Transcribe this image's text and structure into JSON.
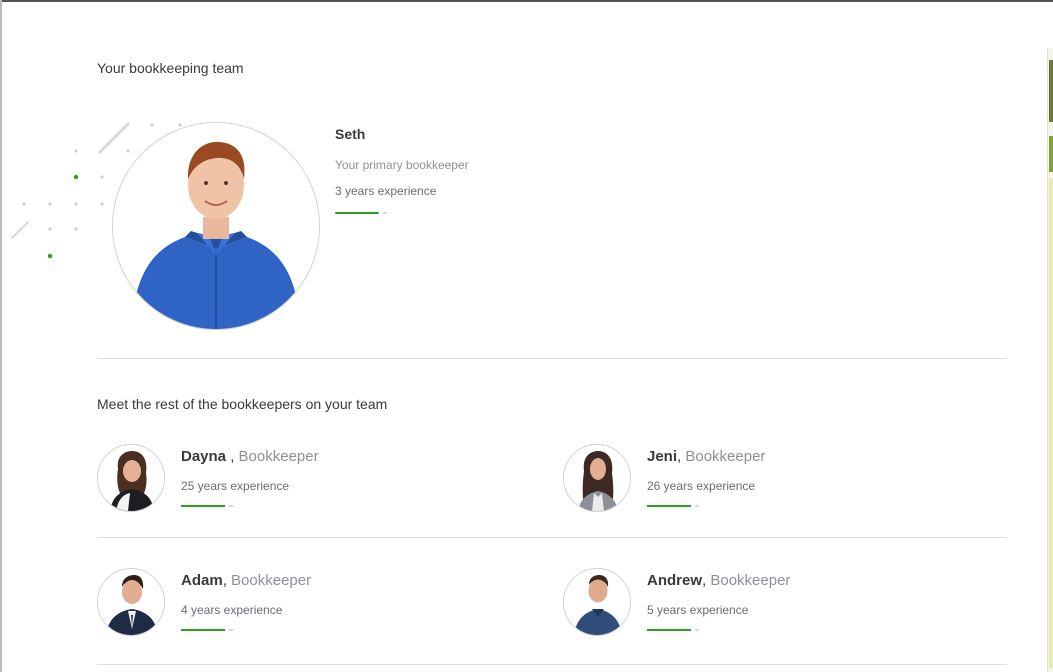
{
  "header": {
    "title": "Your bookkeeping team"
  },
  "primary": {
    "name": "Seth",
    "role": "Your primary bookkeeper",
    "experience": "3 years experience",
    "photo": "person-photo-seth"
  },
  "rest": {
    "title": "Meet the rest of the bookkeepers on your team",
    "members": [
      {
        "name": "Dayna",
        "separator": " , ",
        "role": "Bookkeeper",
        "experience": "25 years experience",
        "photo": "person-photo-dayna"
      },
      {
        "name": "Jeni",
        "separator": ", ",
        "role": "Bookkeeper",
        "experience": "26 years experience",
        "photo": "person-photo-jeni"
      },
      {
        "name": "Adam",
        "separator": ", ",
        "role": "Bookkeeper",
        "experience": "4 years experience",
        "photo": "person-photo-adam"
      },
      {
        "name": "Andrew",
        "separator": ", ",
        "role": "Bookkeeper",
        "experience": "5 years experience",
        "photo": "person-photo-andrew"
      }
    ]
  },
  "colors": {
    "accent_green": "#2ca01c",
    "text_dark": "#393a3d",
    "text_muted": "#8d9096",
    "divider": "#dcdfe3"
  }
}
